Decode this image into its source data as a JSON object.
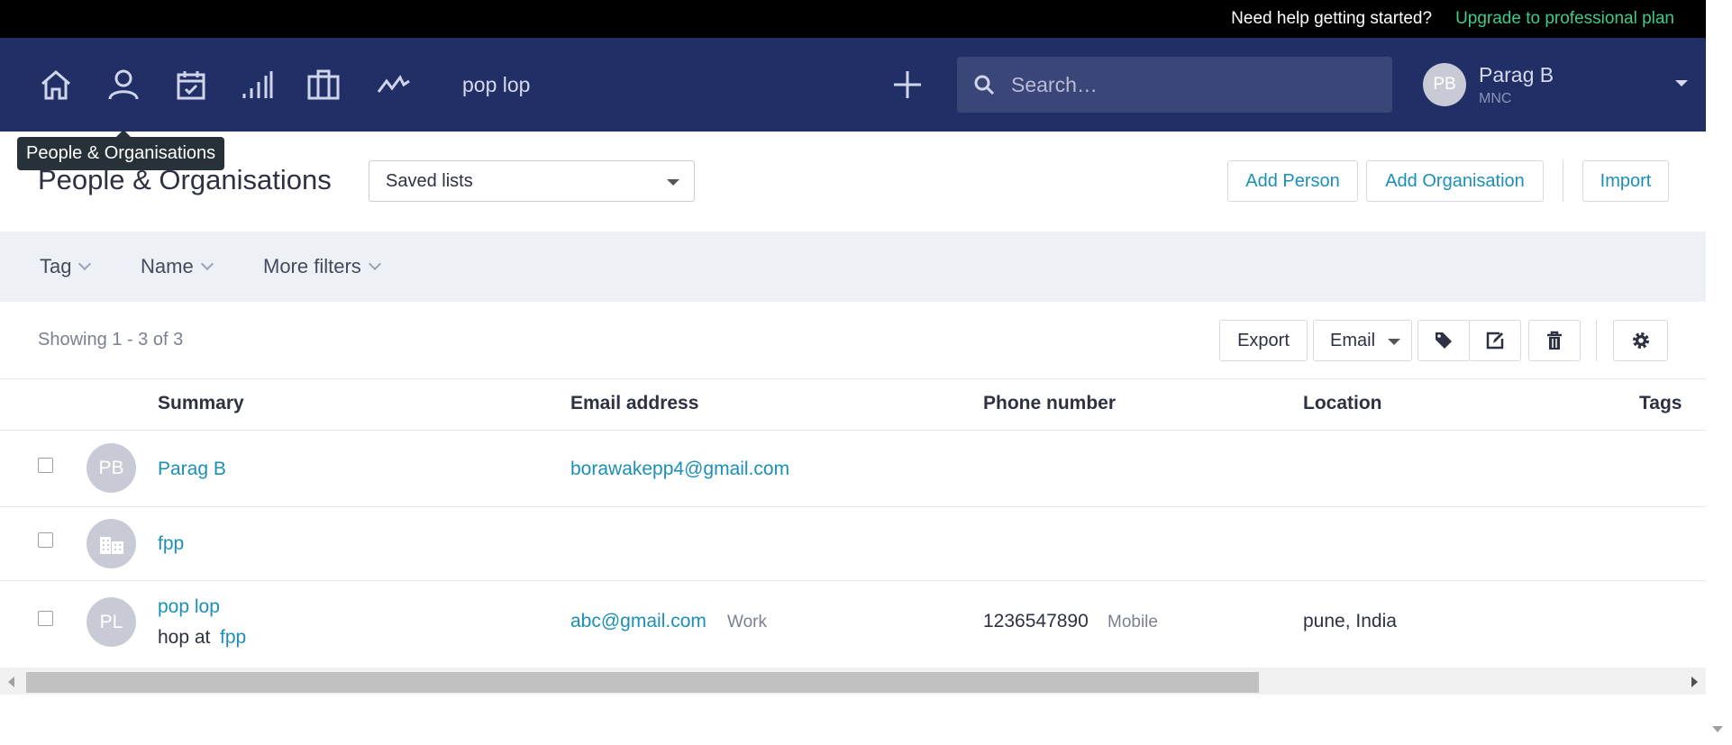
{
  "topbar": {
    "help": "Need help getting started?",
    "upgrade": "Upgrade to professional plan"
  },
  "nav": {
    "recent": "pop lop",
    "search_placeholder": "Search…",
    "user": {
      "initials": "PB",
      "name": "Parag B",
      "org": "MNC"
    },
    "tooltip": "People & Organisations"
  },
  "header": {
    "title": "People & Organisations",
    "saved_lists": "Saved lists",
    "add_person": "Add Person",
    "add_org": "Add Organisation",
    "import": "Import"
  },
  "filters": {
    "tag": "Tag",
    "name": "Name",
    "more": "More filters"
  },
  "toolbar": {
    "showing": "Showing 1 - 3 of 3",
    "export": "Export",
    "email": "Email"
  },
  "table": {
    "headers": {
      "summary": "Summary",
      "email": "Email address",
      "phone": "Phone number",
      "location": "Location",
      "tags": "Tags"
    },
    "rows": [
      {
        "initials": "PB",
        "name": "Parag B",
        "email": "borawakepp4@gmail.com"
      },
      {
        "name": "fpp"
      },
      {
        "initials": "PL",
        "name": "pop lop",
        "job": "hop at",
        "org": "fpp",
        "email": "abc@gmail.com",
        "email_type": "Work",
        "phone": "1236547890",
        "phone_type": "Mobile",
        "location": "pune, India"
      }
    ]
  },
  "colors": {
    "nav_bg": "#222f66",
    "link": "#1b8fb8",
    "upgrade": "#3ecb8a"
  }
}
